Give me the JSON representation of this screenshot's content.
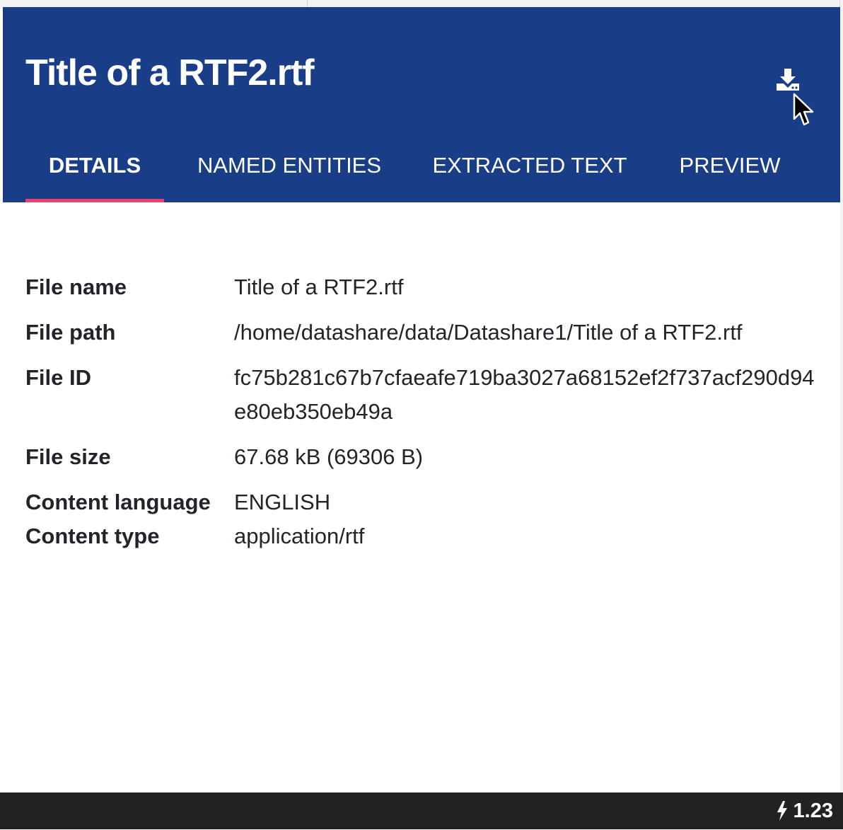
{
  "document": {
    "title": "Title of a RTF2.rtf"
  },
  "header": {
    "download_icon": "download-icon",
    "colors": {
      "header_bg": "#193d87",
      "active_tab_underline": "#ee3f6e"
    }
  },
  "tabs": [
    {
      "label": "DETAILS",
      "active": true
    },
    {
      "label": "NAMED ENTITIES",
      "active": false
    },
    {
      "label": "EXTRACTED TEXT",
      "active": false
    },
    {
      "label": "PREVIEW",
      "active": false
    }
  ],
  "details": [
    {
      "label": "File name",
      "value": "Title of a RTF2.rtf"
    },
    {
      "label": "File path",
      "value": "/home/datashare/data/Datashare1/Title of a RTF2.rtf"
    },
    {
      "label": "File ID",
      "value": "fc75b281c67b7cfaeafe719ba3027a68152ef2f737acf290d94e80eb350eb49a"
    },
    {
      "label": "File size",
      "value": "67.68 kB (69306 B)"
    },
    {
      "label": "Content language",
      "value": "ENGLISH"
    },
    {
      "label": "Content type",
      "value": "application/rtf"
    }
  ],
  "footer": {
    "version": "1.23",
    "version_icon": "bolt-icon"
  }
}
